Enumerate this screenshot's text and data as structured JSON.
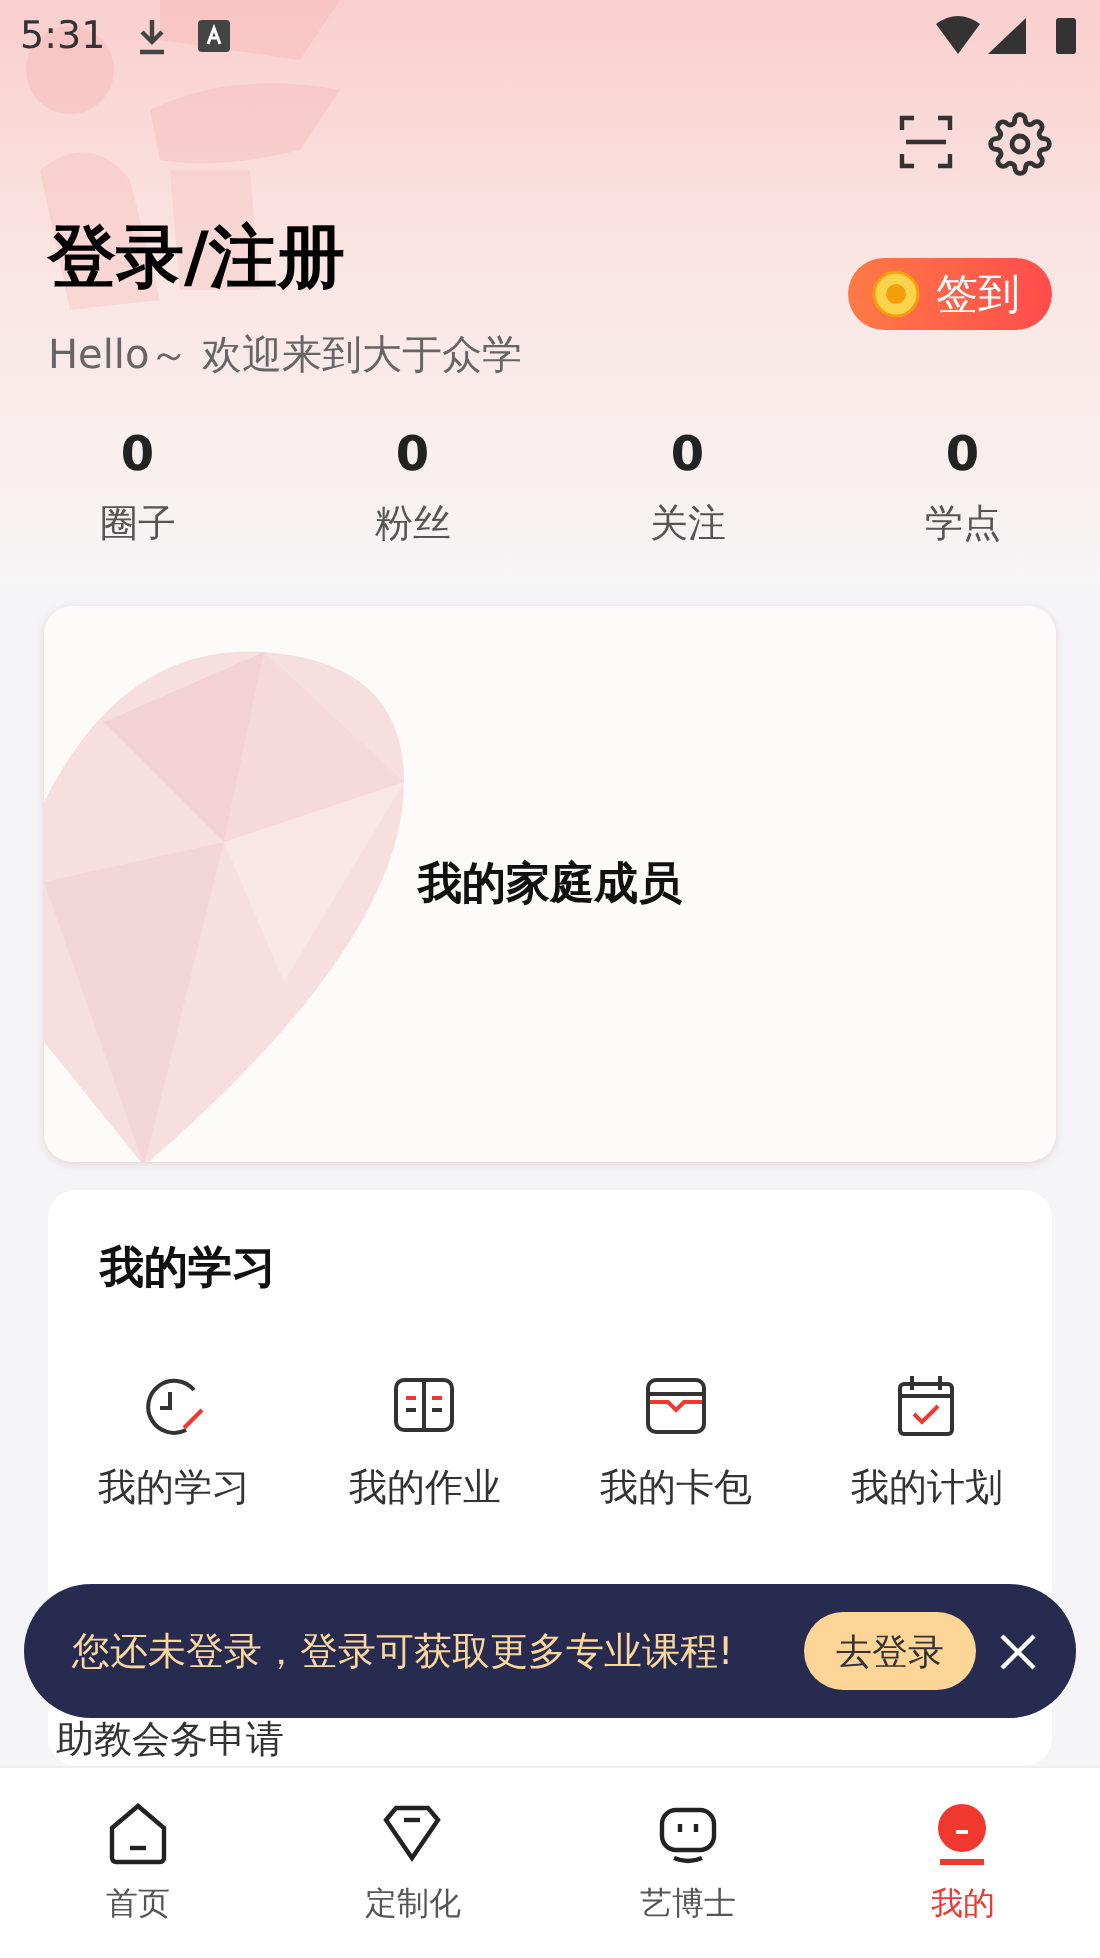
{
  "status_bar": {
    "time": "5:31"
  },
  "header": {
    "title": "登录/注册",
    "subtitle": "Hello～ 欢迎来到大于众学",
    "checkin_button": "签到"
  },
  "stats": [
    {
      "value": "0",
      "label": "圈子"
    },
    {
      "value": "0",
      "label": "粉丝"
    },
    {
      "value": "0",
      "label": "关注"
    },
    {
      "value": "0",
      "label": "学点"
    }
  ],
  "family_card": {
    "title": "我的家庭成员"
  },
  "study_section": {
    "title": "我的学习",
    "items": [
      {
        "kind": "clock",
        "label": "我的学习"
      },
      {
        "kind": "book",
        "label": "我的作业"
      },
      {
        "kind": "wallet",
        "label": "我的卡包"
      },
      {
        "kind": "calendar",
        "label": "我的计划"
      }
    ],
    "next_item": "助教会务申请"
  },
  "login_toast": {
    "message": "您还未登录，登录可获取更多专业课程!",
    "button": "去登录"
  },
  "bottom_nav": [
    {
      "kind": "home",
      "label": "首页",
      "selected": false
    },
    {
      "kind": "diamond",
      "label": "定制化",
      "selected": false
    },
    {
      "kind": "robot",
      "label": "艺博士",
      "selected": false
    },
    {
      "kind": "me",
      "label": "我的",
      "selected": true
    }
  ]
}
